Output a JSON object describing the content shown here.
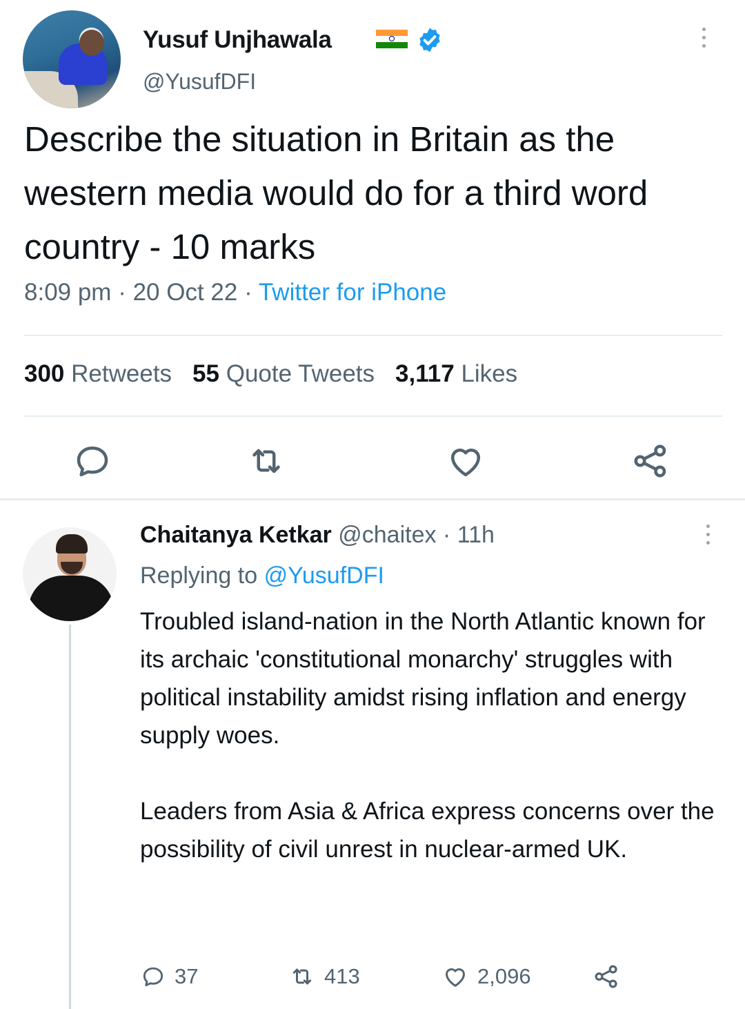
{
  "tweet": {
    "author_name": "Yusuf Unjhawala",
    "handle": "@YusufDFI",
    "text": "Describe the situation in Britain as the western media would do for a third word country - 10 marks",
    "time": "8:09 pm",
    "date": "20 Oct 22",
    "source": "Twitter for iPhone",
    "stats": {
      "retweets_count": "300",
      "retweets_label": "Retweets",
      "quotes_count": "55",
      "quotes_label": "Quote Tweets",
      "likes_count": "3,117",
      "likes_label": "Likes"
    }
  },
  "reply": {
    "author_name": "Chaitanya Ketkar",
    "handle": "@chaitex",
    "age": "11h",
    "replying_prefix": "Replying to",
    "replying_to": "@YusufDFI",
    "paragraph1": "Troubled island-nation in the North Atlantic known for its archaic 'constitutional monarchy' struggles with political instability amidst rising inflation and energy supply woes.",
    "paragraph2": "Leaders from Asia & Africa express concerns over the possibility of civil unrest in nuclear-armed UK.",
    "replies": "37",
    "retweets": "413",
    "likes": "2,096"
  },
  "colors": {
    "link": "#1d9bf0",
    "secondary_text": "#536471",
    "divider": "#e6ecf0",
    "flag_saffron": "#ff9933",
    "flag_green": "#138808",
    "flag_chakra": "#000080"
  },
  "icons": [
    "verified-badge-icon",
    "more-options-icon",
    "reply-icon",
    "retweet-icon",
    "like-icon",
    "share-icon"
  ]
}
